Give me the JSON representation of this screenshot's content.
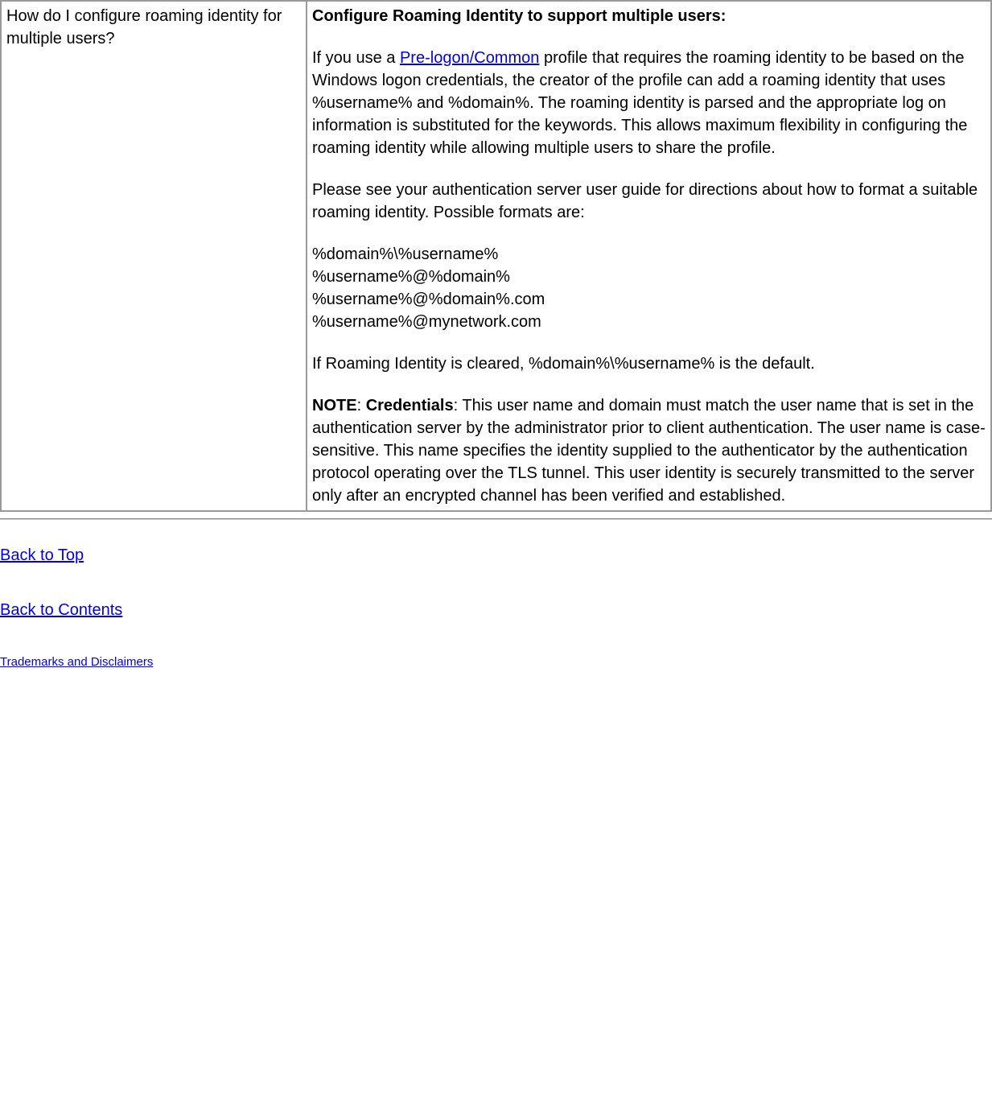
{
  "table": {
    "left": {
      "question": "How do I configure roaming identity for multiple users?"
    },
    "right": {
      "heading": "Configure Roaming Identity to support multiple users:",
      "p1_pre": "If you use a ",
      "p1_link": "Pre-logon/Common",
      "p1_post": " profile that requires the roaming identity to be based on the Windows logon credentials, the creator of the profile can add a roaming identity that uses %username% and %domain%. The roaming identity is parsed and the appropriate log on information is substituted for the keywords. This allows maximum flexibility in configuring the roaming identity while allowing multiple users to share the profile.",
      "p2": "Please see your authentication server user guide for directions about how to format a suitable roaming identity. Possible formats are:",
      "fmt1": "%domain%\\%username%",
      "fmt2": "%username%@%domain%",
      "fmt3": "%username%@%domain%.com",
      "fmt4": "%username%@mynetwork.com",
      "p3": "If Roaming Identity is cleared, %domain%\\%username% is the default.",
      "note_label": "NOTE",
      "note_colon": ": ",
      "cred_label": "Credentials",
      "note_text": ": This user name and domain must match the user name that is set in the authentication server by the administrator prior to client authentication. The user name is case-sensitive. This name specifies the identity supplied to the authenticator by the authentication protocol operating over the TLS tunnel. This user identity is securely transmitted to the server only after an encrypted channel has been verified and established."
    }
  },
  "footer": {
    "back_to_top": "Back to Top",
    "back_to_contents": "Back to Contents",
    "trademarks": "Trademarks and Disclaimers"
  }
}
